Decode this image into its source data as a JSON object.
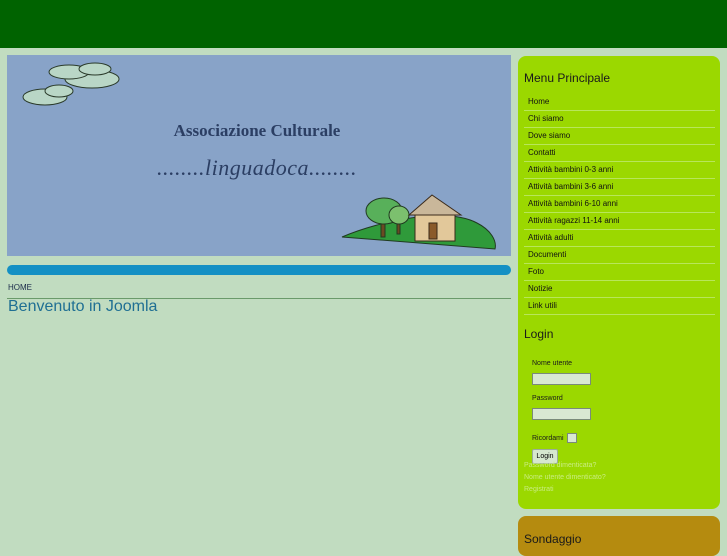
{
  "banner": {
    "title": "Associazione Culturale",
    "subtitle": "........linguadoca........"
  },
  "breadcrumb": "HOME",
  "page_title": "Benvenuto in Joomla",
  "main_menu": {
    "title": "Menu Principale",
    "items": [
      "Home",
      "Chi siamo",
      "Dove siamo",
      "Contatti",
      "Attività bambini 0-3 anni",
      "Attività bambini 3-6 anni",
      "Attività bambini 6-10 anni",
      "Attività ragazzi 11-14 anni",
      "Attività adulti",
      "Documenti",
      "Foto",
      "Notizie",
      "Link utili"
    ]
  },
  "login": {
    "title": "Login",
    "username_label": "Nome utente",
    "username_value": "",
    "password_label": "Password",
    "password_value": "",
    "remember_label": "Ricordami",
    "button": "Login",
    "forgot_password": "Password dimenticata?",
    "forgot_username": "Nome utente dimenticato?",
    "register": "Registrati"
  },
  "poll": {
    "title": "Sondaggio"
  },
  "colors": {
    "top_bar": "#006300",
    "page_bg": "#c1dcc0",
    "sidebar_bg": "#9bd800",
    "poll_bg": "#b58b0f",
    "accent_blue": "#1490c4"
  }
}
